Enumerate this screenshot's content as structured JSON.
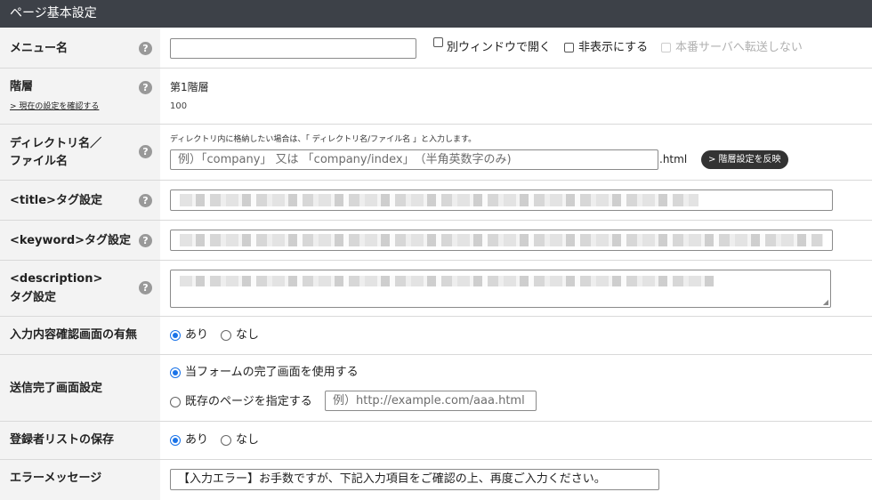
{
  "header": {
    "title": "ページ基本設定"
  },
  "help_icon": "?",
  "menu": {
    "label": "メニュー名",
    "value": "",
    "new_window": "別ウィンドウで開く",
    "hide": "非表示にする",
    "no_transfer": "本番サーバへ転送しない"
  },
  "level": {
    "label": "階層",
    "link": "> 現在の設定を確認する",
    "value": "第1階層",
    "number": "100"
  },
  "directory": {
    "label_line1": "ディレクトリ名／",
    "label_line2": "ファイル名",
    "hint": "ディレクトリ内に格納したい場合は、「 ディレクトリ名/ファイル名 」と入力します。",
    "placeholder": "例）「company」 又は 「company/index」　（半角英数字のみ)",
    "suffix": ".html",
    "button": "> 階層設定を反映"
  },
  "title_tag": {
    "label": "<title>タグ設定"
  },
  "keyword_tag": {
    "label": "<keyword>タグ設定"
  },
  "description_tag": {
    "label_line1": "<description>",
    "label_line2": "タグ設定"
  },
  "confirm": {
    "label": "入力内容確認画面の有無",
    "yes": "あり",
    "no": "なし",
    "selected": "yes"
  },
  "complete": {
    "label": "送信完了画面設定",
    "option1": "当フォームの完了画面を使用する",
    "option2": "既存のページを指定する",
    "url_placeholder": "例）http://example.com/aaa.html",
    "selected": "option1"
  },
  "registrant": {
    "label": "登録者リストの保存",
    "yes": "あり",
    "no": "なし",
    "selected": "yes"
  },
  "error": {
    "label": "エラーメッセージ",
    "value": "【入力エラー】お手数ですが、下記入力項目をご確認の上、再度ご入力ください。"
  }
}
